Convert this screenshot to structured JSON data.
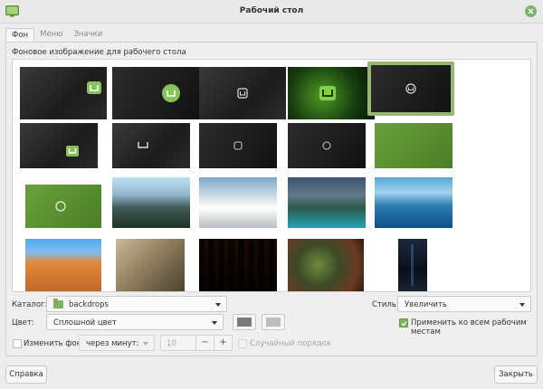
{
  "window": {
    "title": "Рабочий стол"
  },
  "tabs": [
    {
      "label": "Фон",
      "active": true
    },
    {
      "label": "Меню",
      "active": false
    },
    {
      "label": "Значки",
      "active": false
    }
  ],
  "background_section": {
    "label": "Фоновое изображение для рабочего стола"
  },
  "gallery": {
    "selected_index": 4,
    "thumbnails": [
      "mint-dark-curves",
      "mint-dark-circle",
      "mint-dark-diagonal",
      "mint-neon-green",
      "mint-dark-rings",
      "mint-dark-cube",
      "mint-dark-lines",
      "mint-dark-plain",
      "mint-dark-plain-2",
      "mint-green-plain",
      "mint-green-stripes",
      "mountain-clouds",
      "desk-sea-view",
      "mountain-lake",
      "underwater-coral",
      "desert-trees",
      "dry-grass",
      "piano-keys",
      "fern-forest",
      "night-city-tall"
    ]
  },
  "controls": {
    "catalog_label": "Каталог:",
    "catalog_value": "backdrops",
    "style_label": "Стиль:",
    "style_value": "Увеличить",
    "color_label": "Цвет:",
    "color_value": "Сплошной цвет",
    "primary_color": "#7b7b7b",
    "secondary_color": "#bdbdbd",
    "apply_all_label": "Применить ко всем рабочим местам",
    "apply_all_checked": true,
    "change_bg_label": "Изменить фон",
    "change_bg_checked": false,
    "interval_placeholder": "через минут:",
    "interval_value": "10",
    "minus": "−",
    "plus": "+",
    "random_order_label": "Случайный порядок"
  },
  "footer": {
    "help_label": "Справка",
    "close_label": "Закрыть"
  },
  "accent_color": "#7fb35a"
}
